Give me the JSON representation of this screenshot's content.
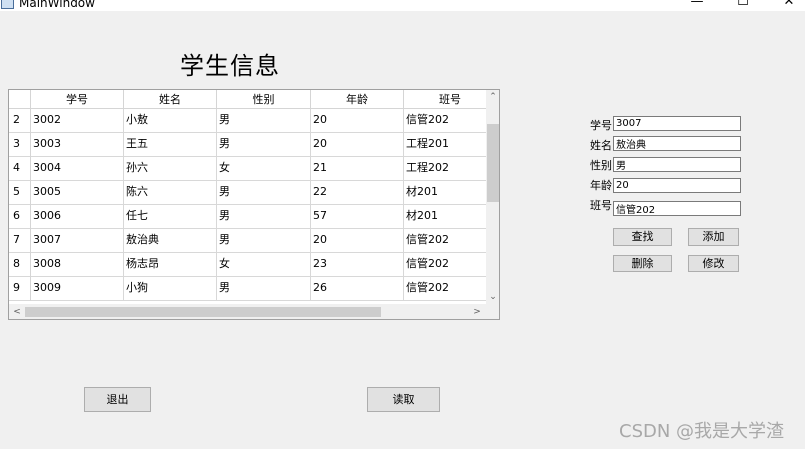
{
  "window": {
    "title": "MainWindow",
    "min_glyph": "—",
    "max_glyph": "☐",
    "close_glyph": "✕"
  },
  "page": {
    "title": "学生信息"
  },
  "table": {
    "columns": [
      "学号",
      "姓名",
      "性别",
      "年龄",
      "班号"
    ],
    "rows": [
      {
        "num": "2",
        "cells": [
          "3002",
          "小敖",
          "男",
          "20",
          "信管202"
        ]
      },
      {
        "num": "3",
        "cells": [
          "3003",
          "王五",
          "男",
          "20",
          "工程201"
        ]
      },
      {
        "num": "4",
        "cells": [
          "3004",
          "孙六",
          "女",
          "21",
          "工程202"
        ]
      },
      {
        "num": "5",
        "cells": [
          "3005",
          "陈六",
          "男",
          "22",
          "材201"
        ]
      },
      {
        "num": "6",
        "cells": [
          "3006",
          "任七",
          "男",
          "57",
          "材201"
        ]
      },
      {
        "num": "7",
        "cells": [
          "3007",
          "敖治典",
          "男",
          "20",
          "信管202"
        ]
      },
      {
        "num": "8",
        "cells": [
          "3008",
          "杨志昂",
          "女",
          "23",
          "信管202"
        ]
      },
      {
        "num": "9",
        "cells": [
          "3009",
          "小狗",
          "男",
          "26",
          "信管202"
        ]
      }
    ]
  },
  "form": {
    "student_id": {
      "label": "学号",
      "value": "3007"
    },
    "name": {
      "label": "姓名",
      "value": "敖治典"
    },
    "gender": {
      "label": "性别",
      "value": "男"
    },
    "age": {
      "label": "年龄",
      "value": "20"
    },
    "class_no": {
      "label": "班号",
      "value": "信管202"
    }
  },
  "buttons": {
    "find": "查找",
    "add": "添加",
    "delete": "删除",
    "modify": "修改",
    "exit": "退出",
    "read": "读取"
  },
  "watermark": "CSDN @我是大学渣"
}
